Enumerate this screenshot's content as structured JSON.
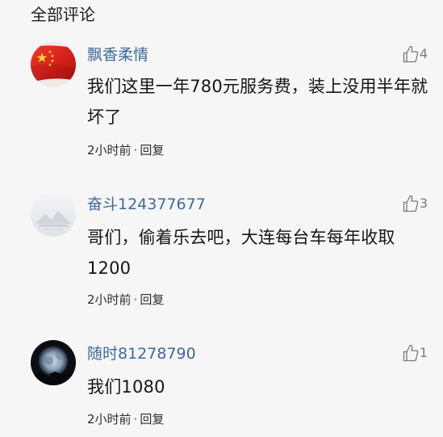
{
  "section_title": "全部评论",
  "comments": [
    {
      "username": "飘香柔情",
      "likes": "4",
      "text": "我们这里一年780元服务费，装上没用半年就坏了",
      "time": "2小时前",
      "separator": "·",
      "reply_label": "回复",
      "avatar_icon": "china-flag-avatar"
    },
    {
      "username": "奋斗124377677",
      "likes": "3",
      "text": "哥们，偷着乐去吧，大连每台车每年收取1200",
      "time": "2小时前",
      "separator": "·",
      "reply_label": "回复",
      "avatar_icon": "default-avatar"
    },
    {
      "username": "随时81278790",
      "likes": "1",
      "text": "我们1080",
      "time": "2小时前",
      "separator": "·",
      "reply_label": "回复",
      "avatar_icon": "night-earth-avatar"
    }
  ],
  "colors": {
    "background": "#f6f6f6",
    "username": "#3f6a9b",
    "text": "#161616",
    "meta": "#2e2e2e",
    "like": "#7a7a7a"
  }
}
